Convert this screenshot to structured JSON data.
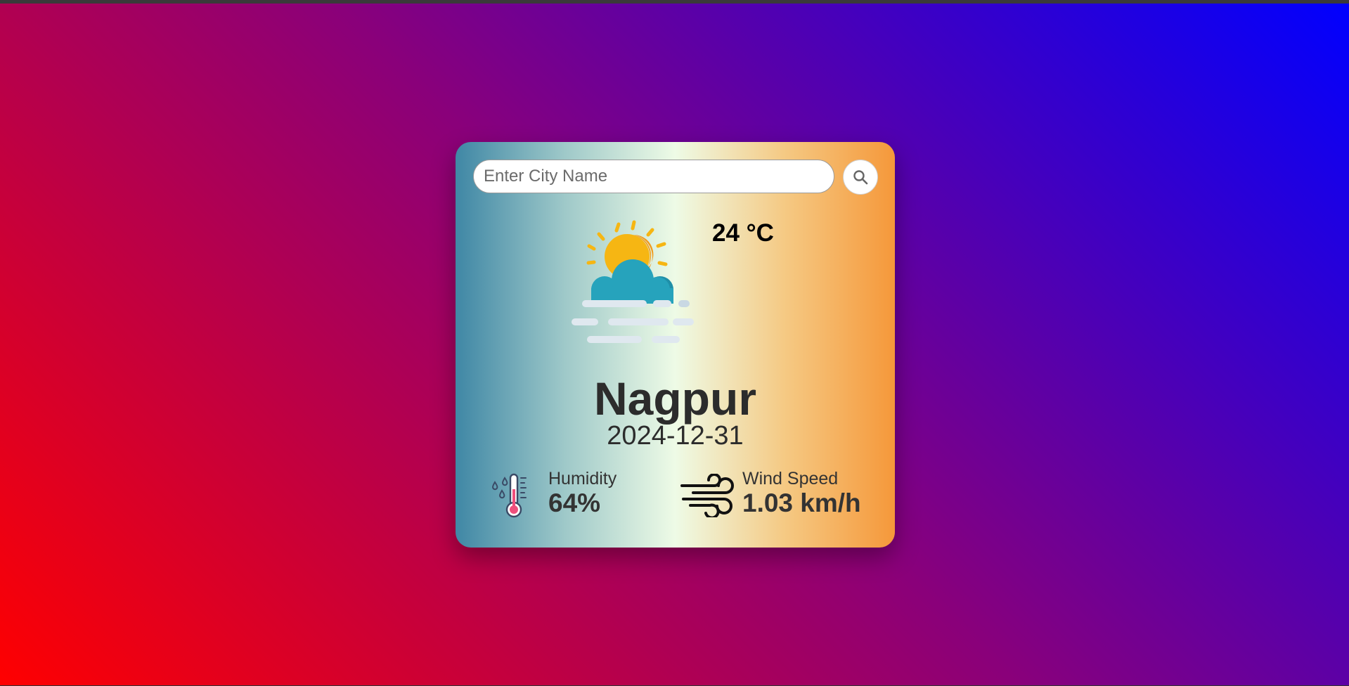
{
  "search": {
    "placeholder": "Enter City Name",
    "value": "",
    "button_icon": "search-icon"
  },
  "weather": {
    "icon": "sun-cloud-fog-icon",
    "temperature": "24 °C",
    "city": "Nagpur",
    "date": "2024-12-31"
  },
  "details": {
    "humidity": {
      "icon": "thermometer-humidity-icon",
      "label": "Humidity",
      "value": "64%"
    },
    "wind": {
      "icon": "wind-icon",
      "label": "Wind Speed",
      "value": "1.03 km/h"
    }
  },
  "colors": {
    "background_start": "#ff0000",
    "background_mid": "#8a007a",
    "background_end": "#0000ff",
    "card_left": "#3f87a5",
    "card_center": "#eefbe6",
    "card_right": "#f5983a",
    "text": "#2c2c2c"
  }
}
